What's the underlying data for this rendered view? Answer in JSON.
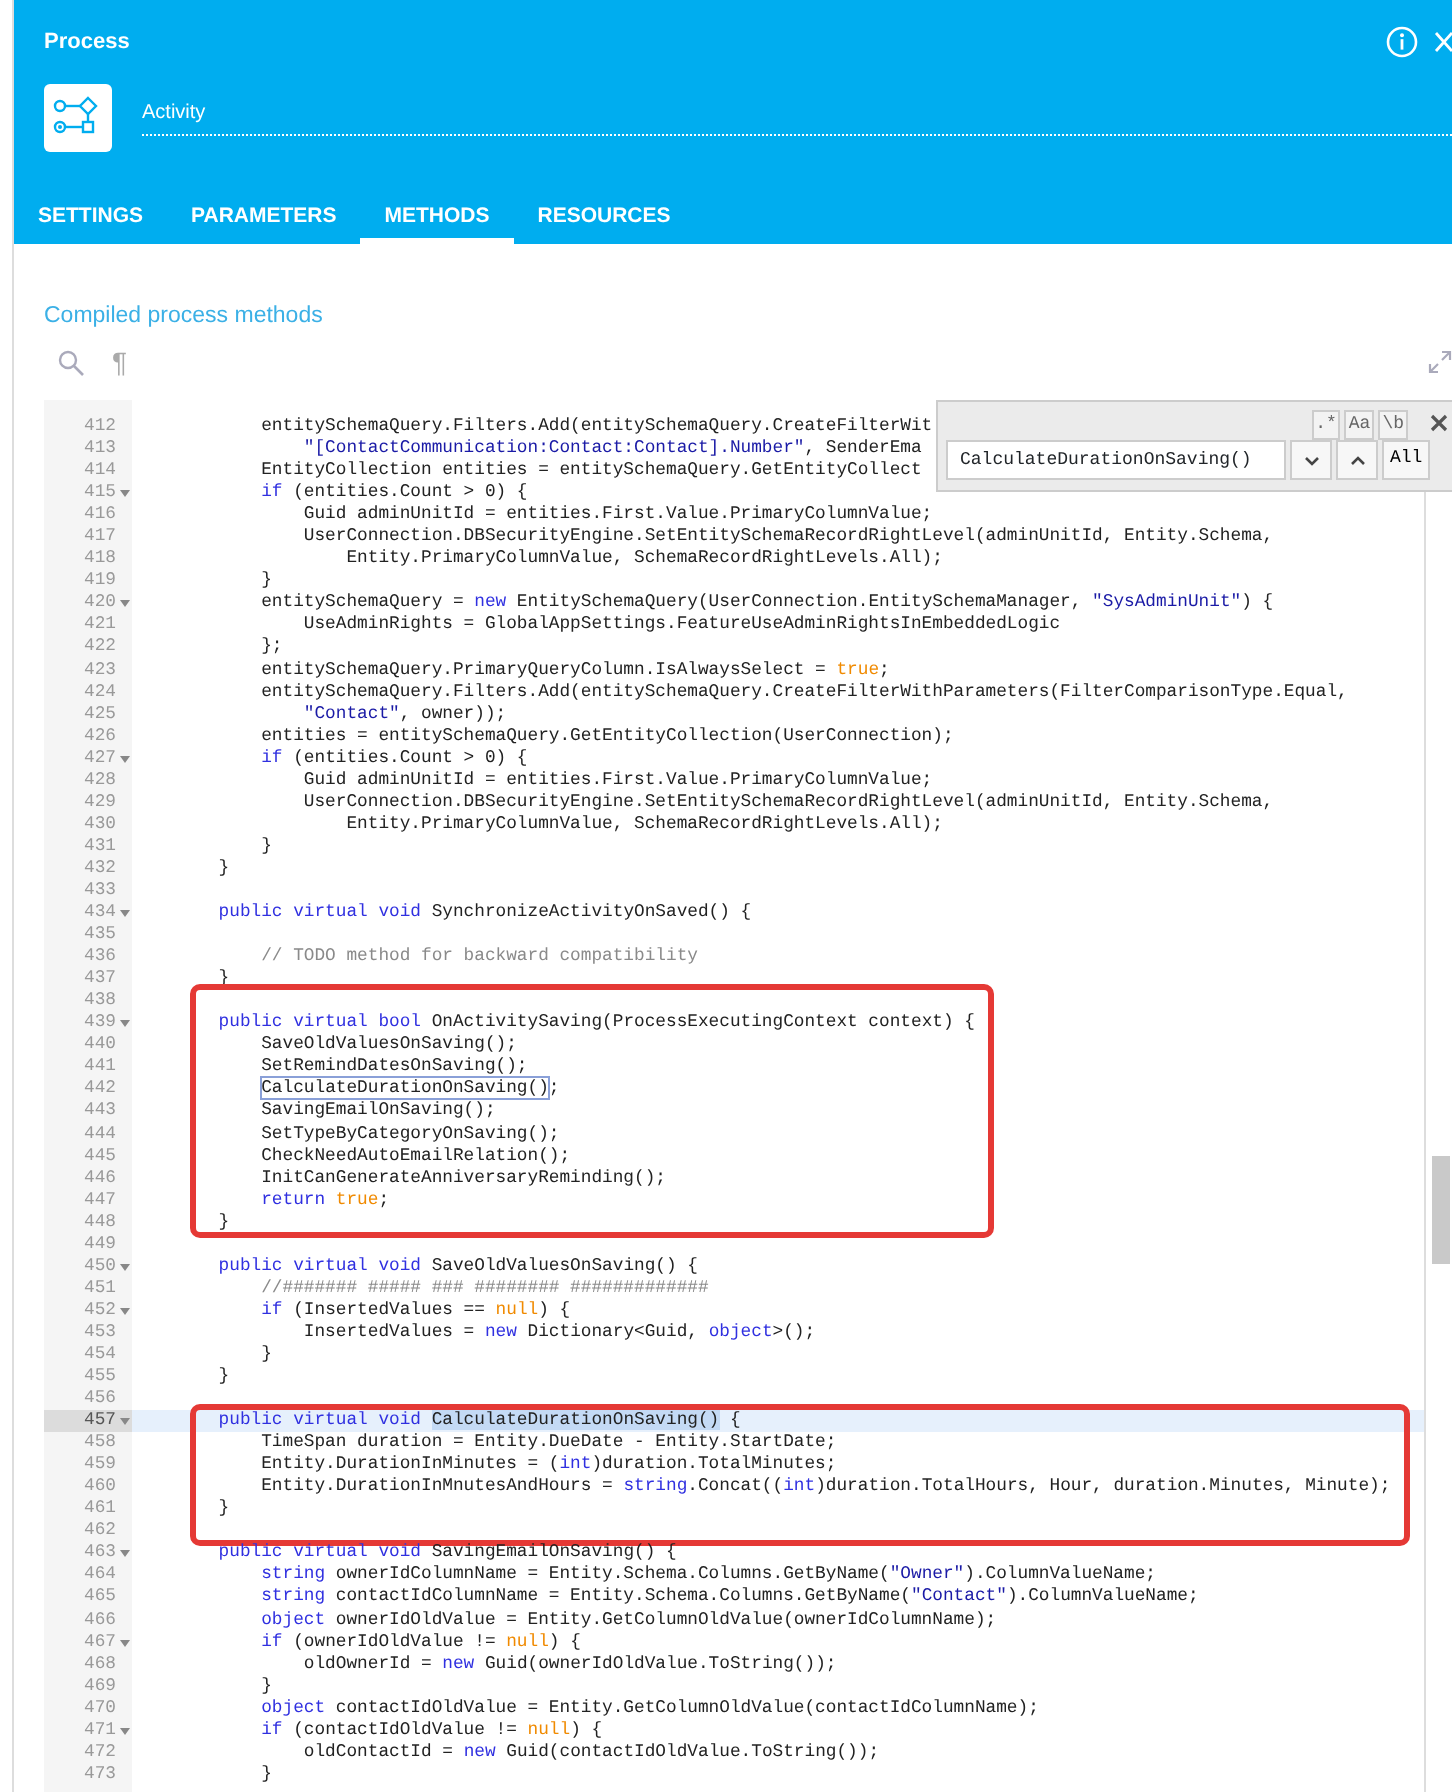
{
  "window": {
    "title": "Process",
    "element": {
      "name": "Activity"
    }
  },
  "tabs": [
    {
      "label": "SETTINGS",
      "selected": false
    },
    {
      "label": "PARAMETERS",
      "selected": false
    },
    {
      "label": "METHODS",
      "selected": true
    },
    {
      "label": "RESOURCES",
      "selected": false
    }
  ],
  "section_title": "Compiled process methods",
  "toolbar": {
    "invisibles": "¶"
  },
  "search_panel": {
    "options": [
      ".*",
      "Aa",
      "\\b"
    ],
    "value": "CalculateDurationOnSaving()",
    "all_button": "All"
  },
  "code": {
    "blocks": [
      {
        "kind": "plain",
        "lines": [
          {
            "number": "412",
            "fold": false,
            "active": false,
            "segments": [
              {
                "kind": "plain",
                "text": "        entitySchemaQuery.Filters.Add(entitySchemaQuery.CreateFilterWit"
              }
            ]
          },
          {
            "number": "413",
            "fold": false,
            "active": false,
            "segments": [
              {
                "kind": "string",
                "text": "            \"[ContactCommunication:Contact:Contact].Number\""
              },
              {
                "kind": "plain",
                "text": ", SenderEma"
              }
            ]
          },
          {
            "number": "414",
            "fold": false,
            "active": false,
            "segments": [
              {
                "kind": "plain",
                "text": "        EntityCollection entities = entitySchemaQuery.GetEntityCollect"
              }
            ]
          },
          {
            "number": "415",
            "fold": true,
            "active": false,
            "segments": [
              {
                "kind": "keyword",
                "text": "        if"
              },
              {
                "kind": "plain",
                "text": " (entities.Count > 0) {"
              }
            ]
          },
          {
            "number": "416",
            "fold": false,
            "active": false,
            "segments": [
              {
                "kind": "plain",
                "text": "            Guid adminUnitId = entities.First.Value.PrimaryColumnValue;"
              }
            ]
          },
          {
            "number": "417",
            "fold": false,
            "active": false,
            "segments": [
              {
                "kind": "plain",
                "text": "            UserConnection.DBSecurityEngine.SetEntitySchemaRecordRightLevel(adminUnitId, Entity.Schema,"
              }
            ]
          },
          {
            "number": "418",
            "fold": false,
            "active": false,
            "segments": [
              {
                "kind": "plain",
                "text": "                Entity.PrimaryColumnValue, SchemaRecordRightLevels.All);"
              }
            ]
          },
          {
            "number": "419",
            "fold": false,
            "active": false,
            "segments": [
              {
                "kind": "plain",
                "text": "        }"
              }
            ]
          },
          {
            "number": "420",
            "fold": true,
            "active": false,
            "segments": [
              {
                "kind": "plain",
                "text": "        entitySchemaQuery = "
              },
              {
                "kind": "keyword",
                "text": "new"
              },
              {
                "kind": "plain",
                "text": " EntitySchemaQuery(UserConnection.EntitySchemaManager, "
              },
              {
                "kind": "string",
                "text": "\"SysAdminUnit\""
              },
              {
                "kind": "plain",
                "text": ") {"
              }
            ]
          },
          {
            "number": "421",
            "fold": false,
            "active": false,
            "segments": [
              {
                "kind": "plain",
                "text": "            UseAdminRights = GlobalAppSettings.FeatureUseAdminRightsInEmbeddedLogic"
              }
            ]
          },
          {
            "number": "422",
            "fold": false,
            "active": false,
            "segments": [
              {
                "kind": "plain",
                "text": "        };"
              }
            ]
          },
          {
            "number": "423",
            "fold": false,
            "active": false,
            "segments": [
              {
                "kind": "plain",
                "text": "        entitySchemaQuery.PrimaryQueryColumn.IsAlwaysSelect = "
              },
              {
                "kind": "constant",
                "text": "true"
              },
              {
                "kind": "plain",
                "text": ";"
              }
            ]
          },
          {
            "number": "424",
            "fold": false,
            "active": false,
            "segments": [
              {
                "kind": "plain",
                "text": "        entitySchemaQuery.Filters.Add(entitySchemaQuery.CreateFilterWithParameters(FilterComparisonType.Equal,"
              }
            ]
          },
          {
            "number": "425",
            "fold": false,
            "active": false,
            "segments": [
              {
                "kind": "string",
                "text": "            \"Contact\""
              },
              {
                "kind": "plain",
                "text": ", owner));"
              }
            ]
          },
          {
            "number": "426",
            "fold": false,
            "active": false,
            "segments": [
              {
                "kind": "plain",
                "text": "        entities = entitySchemaQuery.GetEntityCollection(UserConnection);"
              }
            ]
          },
          {
            "number": "427",
            "fold": true,
            "active": false,
            "segments": [
              {
                "kind": "keyword",
                "text": "        if"
              },
              {
                "kind": "plain",
                "text": " (entities.Count > 0) {"
              }
            ]
          },
          {
            "number": "428",
            "fold": false,
            "active": false,
            "segments": [
              {
                "kind": "plain",
                "text": "            Guid adminUnitId = entities.First.Value.PrimaryColumnValue;"
              }
            ]
          },
          {
            "number": "429",
            "fold": false,
            "active": false,
            "segments": [
              {
                "kind": "plain",
                "text": "            UserConnection.DBSecurityEngine.SetEntitySchemaRecordRightLevel(adminUnitId, Entity.Schema,"
              }
            ]
          },
          {
            "number": "430",
            "fold": false,
            "active": false,
            "segments": [
              {
                "kind": "plain",
                "text": "                Entity.PrimaryColumnValue, SchemaRecordRightLevels.All);"
              }
            ]
          },
          {
            "number": "431",
            "fold": false,
            "active": false,
            "segments": [
              {
                "kind": "plain",
                "text": "        }"
              }
            ]
          },
          {
            "number": "432",
            "fold": false,
            "active": false,
            "segments": [
              {
                "kind": "plain",
                "text": "    }"
              }
            ]
          },
          {
            "number": "433",
            "fold": false,
            "active": false
          },
          {
            "number": "434",
            "fold": true,
            "active": false,
            "segments": [
              {
                "kind": "keyword",
                "text": "    public virtual void"
              },
              {
                "kind": "plain",
                "text": " SynchronizeActivityOnSaved() {"
              }
            ]
          },
          {
            "number": "435",
            "fold": false,
            "active": false
          },
          {
            "number": "436",
            "fold": false,
            "active": false,
            "segments": [
              {
                "kind": "comment",
                "text": "        // TODO method for backward compatibility"
              }
            ]
          },
          {
            "number": "437",
            "fold": false,
            "active": false,
            "segments": [
              {
                "kind": "plain",
                "text": "    }"
              }
            ]
          }
        ]
      },
      {
        "kind": "framed",
        "lines": [
          {
            "number": "438",
            "fold": false,
            "active": false
          },
          {
            "number": "439",
            "fold": true,
            "active": false,
            "segments": [
              {
                "kind": "keyword",
                "text": "    public virtual bool"
              },
              {
                "kind": "plain",
                "text": " OnActivitySaving(ProcessExecutingContext context) {"
              }
            ]
          },
          {
            "number": "440",
            "fold": false,
            "active": false,
            "segments": [
              {
                "kind": "plain",
                "text": "        SaveOldValuesOnSaving();"
              }
            ]
          },
          {
            "number": "441",
            "fold": false,
            "active": false,
            "segments": [
              {
                "kind": "plain",
                "text": "        SetRemindDatesOnSaving();"
              }
            ]
          },
          {
            "number": "442",
            "fold": false,
            "active": false,
            "segments": [
              {
                "kind": "match",
                "text": "        CalculateDurationOnSaving()"
              },
              {
                "kind": "plain",
                "text": ";"
              }
            ]
          },
          {
            "number": "443",
            "fold": false,
            "active": false,
            "segments": [
              {
                "kind": "plain",
                "text": "        SavingEmailOnSaving();"
              }
            ]
          },
          {
            "number": "444",
            "fold": false,
            "active": false,
            "segments": [
              {
                "kind": "plain",
                "text": "        SetTypeByCategoryOnSaving();"
              }
            ]
          },
          {
            "number": "445",
            "fold": false,
            "active": false,
            "segments": [
              {
                "kind": "plain",
                "text": "        CheckNeedAutoEmailRelation();"
              }
            ]
          },
          {
            "number": "446",
            "fold": false,
            "active": false,
            "segments": [
              {
                "kind": "plain",
                "text": "        InitCanGenerateAnniversaryReminding();"
              }
            ]
          },
          {
            "number": "447",
            "fold": false,
            "active": false,
            "segments": [
              {
                "kind": "keyword",
                "text": "        return"
              },
              {
                "kind": "constant",
                "text": " true"
              },
              {
                "kind": "plain",
                "text": ";"
              }
            ]
          },
          {
            "number": "448",
            "fold": false,
            "active": false,
            "segments": [
              {
                "kind": "plain",
                "text": "    }"
              }
            ]
          }
        ]
      },
      {
        "kind": "plain",
        "lines": [
          {
            "number": "449",
            "fold": false,
            "active": false
          },
          {
            "number": "450",
            "fold": true,
            "active": false,
            "segments": [
              {
                "kind": "keyword",
                "text": "    public virtual void"
              },
              {
                "kind": "plain",
                "text": " SaveOldValuesOnSaving() {"
              }
            ]
          },
          {
            "number": "451",
            "fold": false,
            "active": false,
            "segments": [
              {
                "kind": "comment",
                "text": "        //####### ##### ### ######## #############"
              }
            ]
          },
          {
            "number": "452",
            "fold": true,
            "active": false,
            "segments": [
              {
                "kind": "keyword",
                "text": "        if"
              },
              {
                "kind": "plain",
                "text": " (InsertedValues == "
              },
              {
                "kind": "constant",
                "text": "null"
              },
              {
                "kind": "plain",
                "text": ") {"
              }
            ]
          },
          {
            "number": "453",
            "fold": false,
            "active": false,
            "segments": [
              {
                "kind": "plain",
                "text": "            InsertedValues = "
              },
              {
                "kind": "keyword",
                "text": "new"
              },
              {
                "kind": "plain",
                "text": " Dictionary<Guid, "
              },
              {
                "kind": "keyword",
                "text": "object"
              },
              {
                "kind": "plain",
                "text": ">();"
              }
            ]
          },
          {
            "number": "454",
            "fold": false,
            "active": false,
            "segments": [
              {
                "kind": "plain",
                "text": "        }"
              }
            ]
          },
          {
            "number": "455",
            "fold": false,
            "active": false,
            "segments": [
              {
                "kind": "plain",
                "text": "    }"
              }
            ]
          },
          {
            "number": "456",
            "fold": false,
            "active": false
          }
        ]
      },
      {
        "kind": "framed",
        "lines": [
          {
            "number": "457",
            "fold": true,
            "active": true,
            "segments": [
              {
                "kind": "keyword",
                "text": "    public virtual void"
              },
              {
                "kind": "selection",
                "text": " CalculateDurationOnSaving()"
              },
              {
                "kind": "plain",
                "text": " {"
              }
            ]
          },
          {
            "number": "458",
            "fold": false,
            "active": false,
            "segments": [
              {
                "kind": "plain",
                "text": "        TimeSpan duration = Entity.DueDate - Entity.StartDate;"
              }
            ]
          },
          {
            "number": "459",
            "fold": false,
            "active": false,
            "segments": [
              {
                "kind": "plain",
                "text": "        Entity.DurationInMinutes = ("
              },
              {
                "kind": "keyword",
                "text": "int"
              },
              {
                "kind": "plain",
                "text": ")duration.TotalMinutes;"
              }
            ]
          },
          {
            "number": "460",
            "fold": false,
            "active": false,
            "segments": [
              {
                "kind": "plain",
                "text": "        Entity.DurationInMnutesAndHours = "
              },
              {
                "kind": "keyword",
                "text": "string"
              },
              {
                "kind": "plain",
                "text": ".Concat(("
              },
              {
                "kind": "keyword",
                "text": "int"
              },
              {
                "kind": "plain",
                "text": ")duration.TotalHours, Hour, duration.Minutes, Minute);"
              }
            ]
          },
          {
            "number": "461",
            "fold": false,
            "active": false,
            "segments": [
              {
                "kind": "plain",
                "text": "    }"
              }
            ]
          },
          {
            "number": "462",
            "fold": false,
            "active": false
          }
        ]
      },
      {
        "kind": "plain",
        "lines": [
          {
            "number": "463",
            "fold": true,
            "active": false,
            "segments": [
              {
                "kind": "keyword",
                "text": "    public virtual void"
              },
              {
                "kind": "plain",
                "text": " SavingEmailOnSaving() {"
              }
            ]
          },
          {
            "number": "464",
            "fold": false,
            "active": false,
            "segments": [
              {
                "kind": "keyword",
                "text": "        string"
              },
              {
                "kind": "plain",
                "text": " ownerIdColumnName = Entity.Schema.Columns.GetByName("
              },
              {
                "kind": "string",
                "text": "\"Owner\""
              },
              {
                "kind": "plain",
                "text": ").ColumnValueName;"
              }
            ]
          },
          {
            "number": "465",
            "fold": false,
            "active": false,
            "segments": [
              {
                "kind": "keyword",
                "text": "        string"
              },
              {
                "kind": "plain",
                "text": " contactIdColumnName = Entity.Schema.Columns.GetByName("
              },
              {
                "kind": "string",
                "text": "\"Contact\""
              },
              {
                "kind": "plain",
                "text": ").ColumnValueName;"
              }
            ]
          },
          {
            "number": "466",
            "fold": false,
            "active": false,
            "segments": [
              {
                "kind": "keyword",
                "text": "        object"
              },
              {
                "kind": "plain",
                "text": " ownerIdOldValue = Entity.GetColumnOldValue(ownerIdColumnName);"
              }
            ]
          },
          {
            "number": "467",
            "fold": true,
            "active": false,
            "segments": [
              {
                "kind": "keyword",
                "text": "        if"
              },
              {
                "kind": "plain",
                "text": " (ownerIdOldValue != "
              },
              {
                "kind": "constant",
                "text": "null"
              },
              {
                "kind": "plain",
                "text": ") {"
              }
            ]
          },
          {
            "number": "468",
            "fold": false,
            "active": false,
            "segments": [
              {
                "kind": "plain",
                "text": "            oldOwnerId = "
              },
              {
                "kind": "keyword",
                "text": "new"
              },
              {
                "kind": "plain",
                "text": " Guid(ownerIdOldValue.ToString());"
              }
            ]
          },
          {
            "number": "469",
            "fold": false,
            "active": false,
            "segments": [
              {
                "kind": "plain",
                "text": "        }"
              }
            ]
          },
          {
            "number": "470",
            "fold": false,
            "active": false,
            "segments": [
              {
                "kind": "keyword",
                "text": "        object"
              },
              {
                "kind": "plain",
                "text": " contactIdOldValue = Entity.GetColumnOldValue(contactIdColumnName);"
              }
            ]
          },
          {
            "number": "471",
            "fold": true,
            "active": false,
            "segments": [
              {
                "kind": "keyword",
                "text": "        if"
              },
              {
                "kind": "plain",
                "text": " (contactIdOldValue != "
              },
              {
                "kind": "constant",
                "text": "null"
              },
              {
                "kind": "plain",
                "text": ") {"
              }
            ]
          },
          {
            "number": "472",
            "fold": false,
            "active": false,
            "segments": [
              {
                "kind": "plain",
                "text": "            oldContactId = "
              },
              {
                "kind": "keyword",
                "text": "new"
              },
              {
                "kind": "plain",
                "text": " Guid(contactIdOldValue.ToString());"
              }
            ]
          },
          {
            "number": "473",
            "fold": false,
            "active": false,
            "segments": [
              {
                "kind": "plain",
                "text": "        }"
              }
            ]
          }
        ]
      }
    ]
  }
}
